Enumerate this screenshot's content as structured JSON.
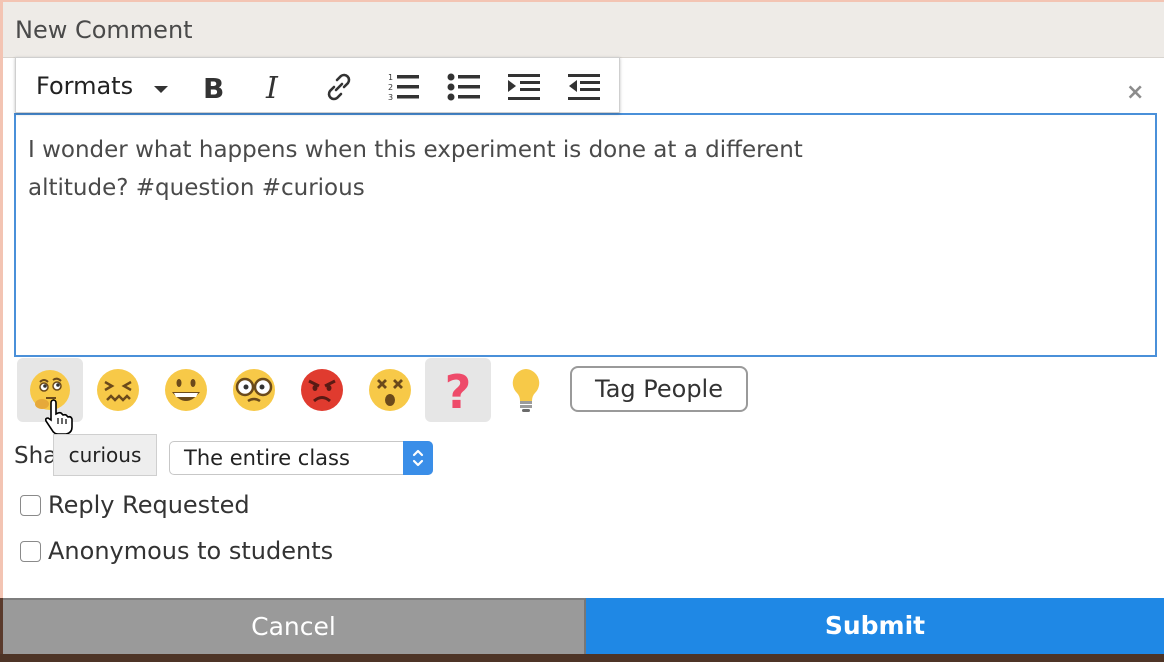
{
  "header": {
    "title": "New Comment"
  },
  "toolbar": {
    "formats_label": "Formats",
    "buttons": [
      "bold-icon",
      "italic-icon",
      "link-icon",
      "numbered-list-icon",
      "bullet-list-icon",
      "indent-icon",
      "outdent-icon"
    ]
  },
  "editor": {
    "line1": "I wonder what happens when this experiment is done at a different",
    "line2": "altitude? #question #curious",
    "close": "×"
  },
  "emojis": [
    {
      "name": "curious",
      "icon": "thinking-face-icon",
      "selected": true
    },
    {
      "name": "confused",
      "icon": "confounded-face-icon",
      "selected": false
    },
    {
      "name": "happy",
      "icon": "grinning-face-icon",
      "selected": false
    },
    {
      "name": "nerd",
      "icon": "glasses-face-icon",
      "selected": false
    },
    {
      "name": "angry",
      "icon": "angry-face-icon",
      "selected": false
    },
    {
      "name": "shocked",
      "icon": "dizzy-face-icon",
      "selected": false
    },
    {
      "name": "question",
      "icon": "question-mark-icon",
      "selected": true
    },
    {
      "name": "idea",
      "icon": "lightbulb-icon",
      "selected": false
    }
  ],
  "tag_button": "Tag People",
  "share": {
    "label": "Sha",
    "tooltip": "curious",
    "selected": "The entire class"
  },
  "options": {
    "reply_requested": "Reply Requested",
    "anonymous": "Anonymous to students"
  },
  "actions": {
    "cancel": "Cancel",
    "submit": "Submit"
  },
  "colors": {
    "submit": "#1f88e5",
    "cancel": "#9a9a9a",
    "focus_border": "#4a90d9"
  }
}
